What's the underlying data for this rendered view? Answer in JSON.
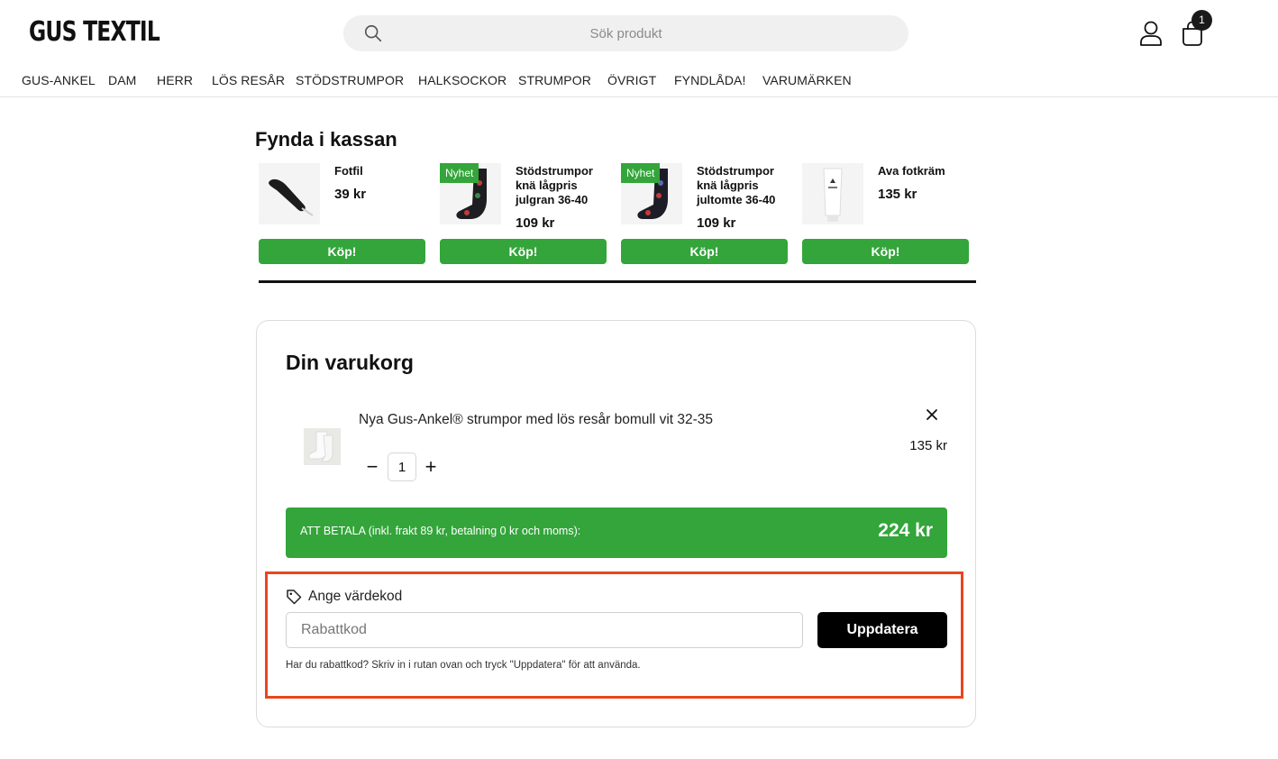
{
  "header": {
    "logo": "GUS TEXTIL",
    "search_placeholder": "Sök produkt",
    "cart_count": "1"
  },
  "nav": [
    "GUS-ANKEL",
    "DAM",
    "HERR",
    "LÖS RESÅR",
    "STÖDSTRUMPOR",
    "HALKSOCKOR",
    "STRUMPOR",
    "ÖVRIGT",
    "FYNDLÅDA!",
    "VARUMÄRKEN"
  ],
  "fynda": {
    "title": "Fynda i kassan",
    "products": [
      {
        "name": "Fotfil",
        "price": "39 kr",
        "badge": "",
        "buy_label": "Köp!"
      },
      {
        "name": "Stödstrumpor knä lågpris julgran 36-40",
        "price": "109 kr",
        "badge": "Nyhet",
        "buy_label": "Köp!"
      },
      {
        "name": "Stödstrumpor knä lågpris jultomte 36-40",
        "price": "109 kr",
        "badge": "Nyhet",
        "buy_label": "Köp!"
      },
      {
        "name": "Ava fotkräm",
        "price": "135 kr",
        "badge": "",
        "buy_label": "Köp!"
      }
    ]
  },
  "cart": {
    "title": "Din varukorg",
    "item": {
      "name": "Nya Gus-Ankel® strumpor med lös resår bomull vit 32-35",
      "price": "135 kr",
      "quantity": "1",
      "minus": "−",
      "plus": "+"
    },
    "total_label": "ATT BETALA (inkl. frakt 89 kr, betalning 0 kr och moms):",
    "total_value": "224 kr",
    "coupon": {
      "label": "Ange värdekod",
      "placeholder": "Rabattkod",
      "button": "Uppdatera",
      "help": "Har du rabattkod? Skriv in i rutan ovan och tryck \"Uppdatera\" för att använda."
    }
  },
  "colors": {
    "green": "#33a53a",
    "highlight": "#e8461f",
    "dark": "#111111"
  }
}
